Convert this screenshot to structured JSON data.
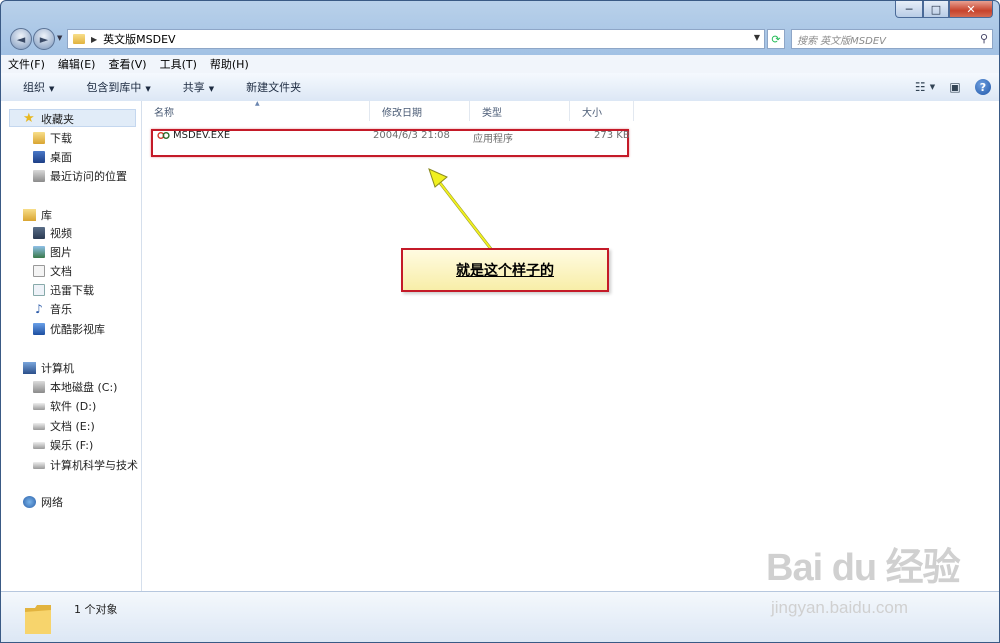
{
  "window": {
    "buttons": {
      "min": "─",
      "max": "□",
      "close": "✕"
    }
  },
  "navigation": {
    "back_glyph": "◄",
    "forward_glyph": "►",
    "address_path": "英文版MSDEV",
    "search_placeholder": "搜索 英文版MSDEV"
  },
  "menubar": {
    "items": [
      "文件(F)",
      "编辑(E)",
      "查看(V)",
      "工具(T)",
      "帮助(H)"
    ]
  },
  "toolbar": {
    "organize": "组织",
    "include_in_library": "包含到库中",
    "share": "共享",
    "new_folder": "新建文件夹"
  },
  "nav_pane": {
    "favorites": {
      "label": "收藏夹",
      "items": [
        "下载",
        "桌面",
        "最近访问的位置"
      ]
    },
    "libraries": {
      "label": "库",
      "items": [
        "视频",
        "图片",
        "文档",
        "迅雷下载",
        "音乐",
        "优酷影视库"
      ]
    },
    "computer": {
      "label": "计算机",
      "items": [
        "本地磁盘 (C:)",
        "软件 (D:)",
        "文档 (E:)",
        "娱乐 (F:)",
        "计算机科学与技术 ("
      ]
    },
    "network": {
      "label": "网络"
    }
  },
  "columns": [
    "名称",
    "修改日期",
    "类型",
    "大小"
  ],
  "files": [
    {
      "name": "MSDEV.EXE",
      "modified": "2004/6/3 21:08",
      "type": "应用程序",
      "size": "273 KB"
    }
  ],
  "annotation": {
    "callout_text": "就是这个样子的",
    "highlight_color": "#c41a28",
    "arrow_color": "#f0f020"
  },
  "status": {
    "count_text": "1 个对象"
  },
  "watermark": {
    "logo": "Bai du 经验",
    "url": "jingyan.baidu.com"
  }
}
